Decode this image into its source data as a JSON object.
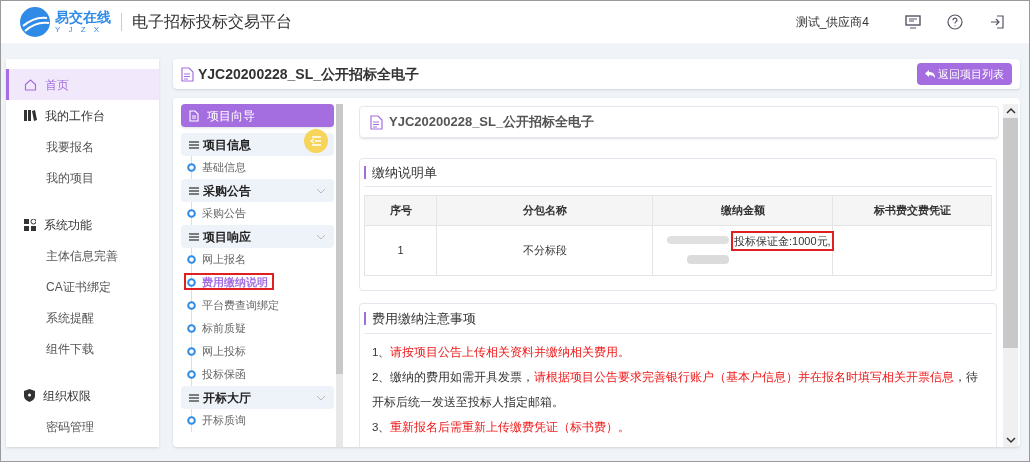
{
  "header": {
    "logo_text": "易交在线",
    "logo_letters": "Y J Z X",
    "title": "电子招标投标交易平台",
    "user": "测试_供应商4"
  },
  "sidebar": {
    "items": [
      {
        "label": "首页",
        "kind": "group",
        "selected": true
      },
      {
        "label": "我的工作台",
        "kind": "group",
        "selected": false
      },
      {
        "label": "我要报名",
        "kind": "item",
        "selected": false
      },
      {
        "label": "我的项目",
        "kind": "item",
        "selected": false
      },
      {
        "label": "系统功能",
        "kind": "group",
        "selected": false
      },
      {
        "label": "主体信息完善",
        "kind": "item",
        "selected": false
      },
      {
        "label": "CA证书绑定",
        "kind": "item",
        "selected": false
      },
      {
        "label": "系统提醒",
        "kind": "item",
        "selected": false
      },
      {
        "label": "组件下载",
        "kind": "item",
        "selected": false
      },
      {
        "label": "组织权限",
        "kind": "group",
        "selected": false
      },
      {
        "label": "密码管理",
        "kind": "item",
        "selected": false
      }
    ]
  },
  "page_title": "YJC20200228_SL_公开招标全电子",
  "back_button": "返回项目列表",
  "guide": {
    "title": "项目向导",
    "sections": [
      {
        "label": "项目信息",
        "expanded": true,
        "children": [
          {
            "label": "基础信息",
            "selected": false
          }
        ]
      },
      {
        "label": "采购公告",
        "expanded": false,
        "children": [
          {
            "label": "采购公告",
            "selected": false
          }
        ]
      },
      {
        "label": "项目响应",
        "expanded": false,
        "children": [
          {
            "label": "网上报名",
            "selected": false
          },
          {
            "label": "费用缴纳说明",
            "selected": true
          },
          {
            "label": "平台费查询绑定",
            "selected": false
          },
          {
            "label": "标前质疑",
            "selected": false
          },
          {
            "label": "网上投标",
            "selected": false
          },
          {
            "label": "投标保函",
            "selected": false
          }
        ]
      },
      {
        "label": "开标大厅",
        "expanded": false,
        "children": [
          {
            "label": "开标质询",
            "selected": false
          }
        ]
      }
    ]
  },
  "content_title": "YJC20200228_SL_公开招标全电子",
  "payment": {
    "title": "缴纳说明单",
    "columns": [
      "序号",
      "分包名称",
      "缴纳金额",
      "标书费交费凭证"
    ],
    "rows": [
      {
        "index": "1",
        "package": "不分标段",
        "amount": "投标保证金:1000元,"
      }
    ]
  },
  "notes": {
    "title": "费用缴纳注意事项",
    "items": [
      [
        {
          "text": "1、",
          "red": false
        },
        {
          "text": "请按项目公告上传相关资料并缴纳相关费用。",
          "red": true
        }
      ],
      [
        {
          "text": "2、缴纳的费用如需开具发票，",
          "red": false
        },
        {
          "text": "请根据项目公告要求完善银行账户（基本户信息）并在报名时填写相关开票信息",
          "red": true
        },
        {
          "text": "，待开标后统一发送至投标人指定邮箱。",
          "red": false
        }
      ],
      [
        {
          "text": "3、",
          "red": false
        },
        {
          "text": "重新报名后需重新上传缴费凭证（标书费）。",
          "red": true
        }
      ]
    ]
  }
}
